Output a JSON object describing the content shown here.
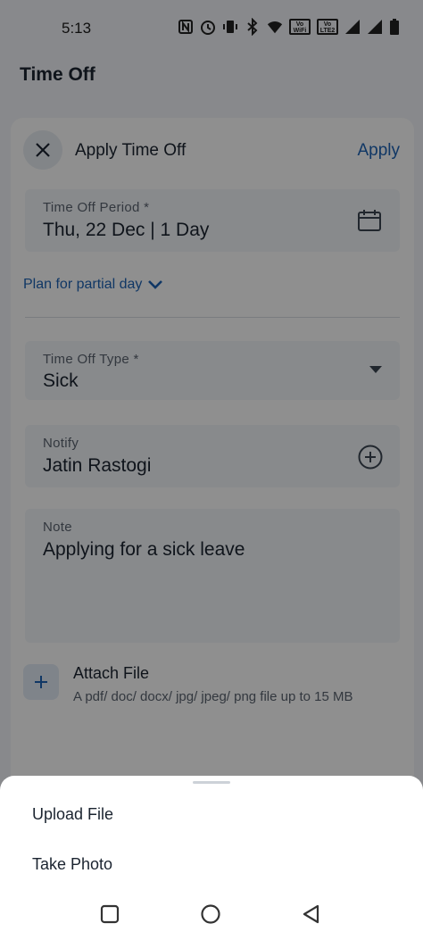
{
  "status_bar": {
    "time": "5:13",
    "icons": [
      "nfc-icon",
      "alarm-icon",
      "vibrate-icon",
      "bluetooth-icon",
      "wifi-icon",
      "volte-wifi-badge",
      "volte-lte2-badge",
      "signal-icon",
      "signal-icon",
      "battery-icon"
    ],
    "badge_1": "Vo WiFi",
    "badge_2": "Vo LTE2"
  },
  "app_bar": {
    "title": "Time Off"
  },
  "dialog": {
    "title": "Apply Time Off",
    "apply_label": "Apply",
    "period": {
      "label": "Time Off Period *",
      "value": "Thu, 22 Dec | 1 Day"
    },
    "partial_day_label": "Plan for partial day",
    "type": {
      "label": "Time Off Type *",
      "value": "Sick"
    },
    "notify": {
      "label": "Notify",
      "value": "Jatin Rastogi"
    },
    "note": {
      "label": "Note",
      "value": "Applying for a sick leave"
    },
    "attach": {
      "title": "Attach File",
      "hint": "A pdf/ doc/ docx/ jpg/ jpeg/ png file up to 15 MB"
    }
  },
  "bottom_sheet": {
    "items": [
      {
        "label": "Upload File"
      },
      {
        "label": "Take Photo"
      }
    ]
  },
  "colors": {
    "accent": "#1e63b5",
    "scrim": "rgba(0,0,0,0.44)"
  }
}
